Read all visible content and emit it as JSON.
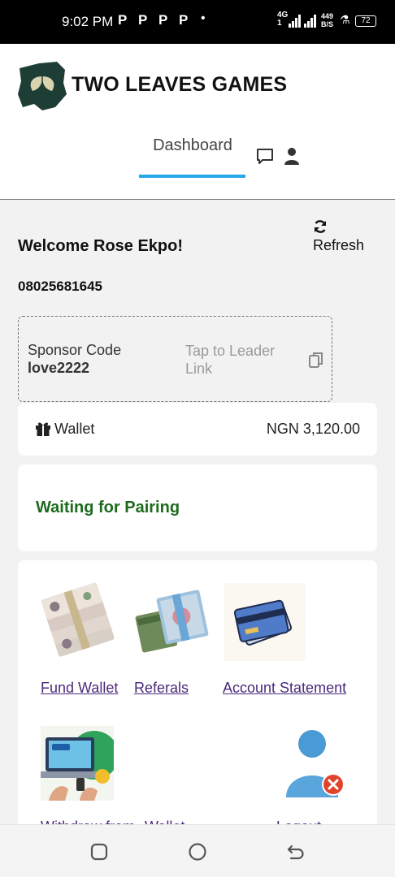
{
  "status_bar": {
    "time": "9:02 PM",
    "notification_letters": [
      "P",
      "P",
      "P",
      "P"
    ],
    "dot": "•",
    "network": "4G",
    "network_sub": "1",
    "speed_value": "449",
    "speed_unit": "B/S",
    "battery": "72"
  },
  "header": {
    "brand": "TWO LEAVES GAMES",
    "tabs": [
      {
        "label": "Dashboard",
        "active": true
      }
    ],
    "icons": [
      "chat-icon",
      "user-icon"
    ]
  },
  "main": {
    "refresh_label": "Refresh",
    "welcome": "Welcome Rose Ekpo!",
    "phone": "08025681645",
    "sponsor": {
      "label": "Sponsor Code",
      "code": "love2222",
      "leader_link": "Tap to Leader Link"
    },
    "wallet": {
      "label": "Wallet",
      "amount": "NGN 3,120.00"
    },
    "pairing_status": "Waiting for Pairing",
    "menu": [
      {
        "label": "Fund Wallet",
        "icon": "cash-stack-icon"
      },
      {
        "label": "Referals",
        "icon": "money-bundle-icon"
      },
      {
        "label": "Account Statement",
        "icon": "credit-card-icon"
      },
      {
        "label": "Withdraw from",
        "icon": "cashout-laptop-icon"
      },
      {
        "label": "Wallet",
        "icon": ""
      },
      {
        "label": "Logout",
        "icon": "remove-user-icon"
      }
    ]
  },
  "colors": {
    "accent": "#29a8e8",
    "pairing": "#1d6b1d",
    "link": "#4b2a7b"
  }
}
